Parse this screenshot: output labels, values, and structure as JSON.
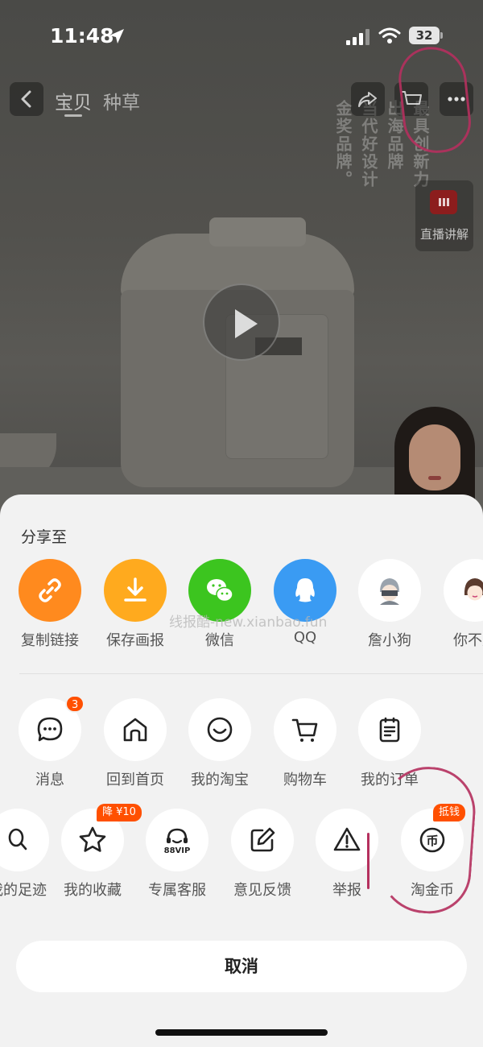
{
  "status_bar": {
    "time": "11:48",
    "battery": "32"
  },
  "top_nav": {
    "tabs": [
      {
        "label": "宝贝",
        "active": true
      },
      {
        "label": "种草",
        "active": false
      }
    ]
  },
  "overlay": {
    "vertical_texts": [
      "金奖品牌。",
      "当代好设计",
      "出海品牌",
      "最具创新力"
    ],
    "live_label": "直播讲解"
  },
  "share_sheet": {
    "title": "分享至",
    "share_targets": [
      {
        "label": "复制链接",
        "icon": "link-icon",
        "color": "#ff8a1e"
      },
      {
        "label": "保存画报",
        "icon": "download-icon",
        "color": "#ffaa1e"
      },
      {
        "label": "微信",
        "icon": "wechat-icon",
        "color": "#3cc51f"
      },
      {
        "label": "QQ",
        "icon": "qq-icon",
        "color": "#3a9bf3"
      },
      {
        "label": "詹小狗",
        "icon": "avatar-icon",
        "color": "#ffffff"
      },
      {
        "label": "你不是",
        "icon": "avatar-icon",
        "color": "#ffffff"
      }
    ],
    "watermark": "线报酷-new.xianbao.fun",
    "actions_row1": [
      {
        "label": "消息",
        "icon": "message-icon",
        "badge": "3"
      },
      {
        "label": "回到首页",
        "icon": "home-icon"
      },
      {
        "label": "我的淘宝",
        "icon": "smile-icon"
      },
      {
        "label": "购物车",
        "icon": "cart-icon"
      },
      {
        "label": "我的订单",
        "icon": "order-icon"
      }
    ],
    "actions_row2": [
      {
        "label": "我的足迹",
        "icon": "footprint-icon"
      },
      {
        "label": "我的收藏",
        "icon": "star-icon",
        "badge": "降 ¥10"
      },
      {
        "label": "专属客服",
        "icon": "vip-service-icon",
        "icon_text": "88VIP"
      },
      {
        "label": "意见反馈",
        "icon": "edit-icon"
      },
      {
        "label": "举报",
        "icon": "warning-icon"
      },
      {
        "label": "淘金币",
        "icon": "coin-icon",
        "icon_text": "币",
        "badge": "抵钱"
      }
    ],
    "cancel_label": "取消",
    "accent_color": "#ff5000"
  }
}
